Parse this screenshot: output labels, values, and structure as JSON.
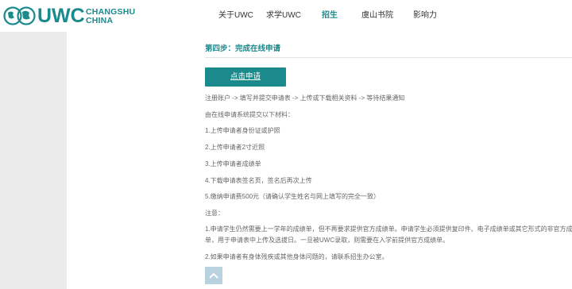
{
  "brand": {
    "word": "UWC",
    "sub1": "CHANGSHU",
    "sub2": "CHINA",
    "color": "#1a8a8c"
  },
  "nav": {
    "items": [
      {
        "label": "关于UWC"
      },
      {
        "label": "求学UWC"
      },
      {
        "label": "招生",
        "active": true
      },
      {
        "label": "虞山书院"
      },
      {
        "label": "影响力"
      }
    ]
  },
  "main": {
    "step_title": "第四步：完成在线申请",
    "apply_button": "点击申请",
    "process": "注册账户 -> 填写并提交申请表 -> 上传或下载相关资料 -> 等待结果通知",
    "materials_intro": "由在线申请系统提交以下材料：",
    "materials": [
      "1.上传申请者身份证或护照",
      "2.上传申请者2寸近照",
      "3.上传申请者成绩单",
      "4.下载申请表签名页，签名后再次上传",
      "5.缴纳申请费500元（请确认学生姓名与网上填写的完全一致）"
    ],
    "notes_title": "注意：",
    "note1_line1": "1.申请学生仍然需要上一学年的成绩单，但不再要求提供官方成绩单。申请学生必须提供复印件、电子成绩单或其它形式的非官方成绩",
    "note1_line2": "单，用于申请表中上传及选拔日。一旦被UWC录取，则需要在入学前提供官方成绩单。",
    "note2": "2.如果申请者有身体残疾或其他身体问题的，请联系招生办公室。"
  },
  "icons": {
    "logo": "globe-logo-icon",
    "scroll_top": "chevron-up-icon"
  }
}
